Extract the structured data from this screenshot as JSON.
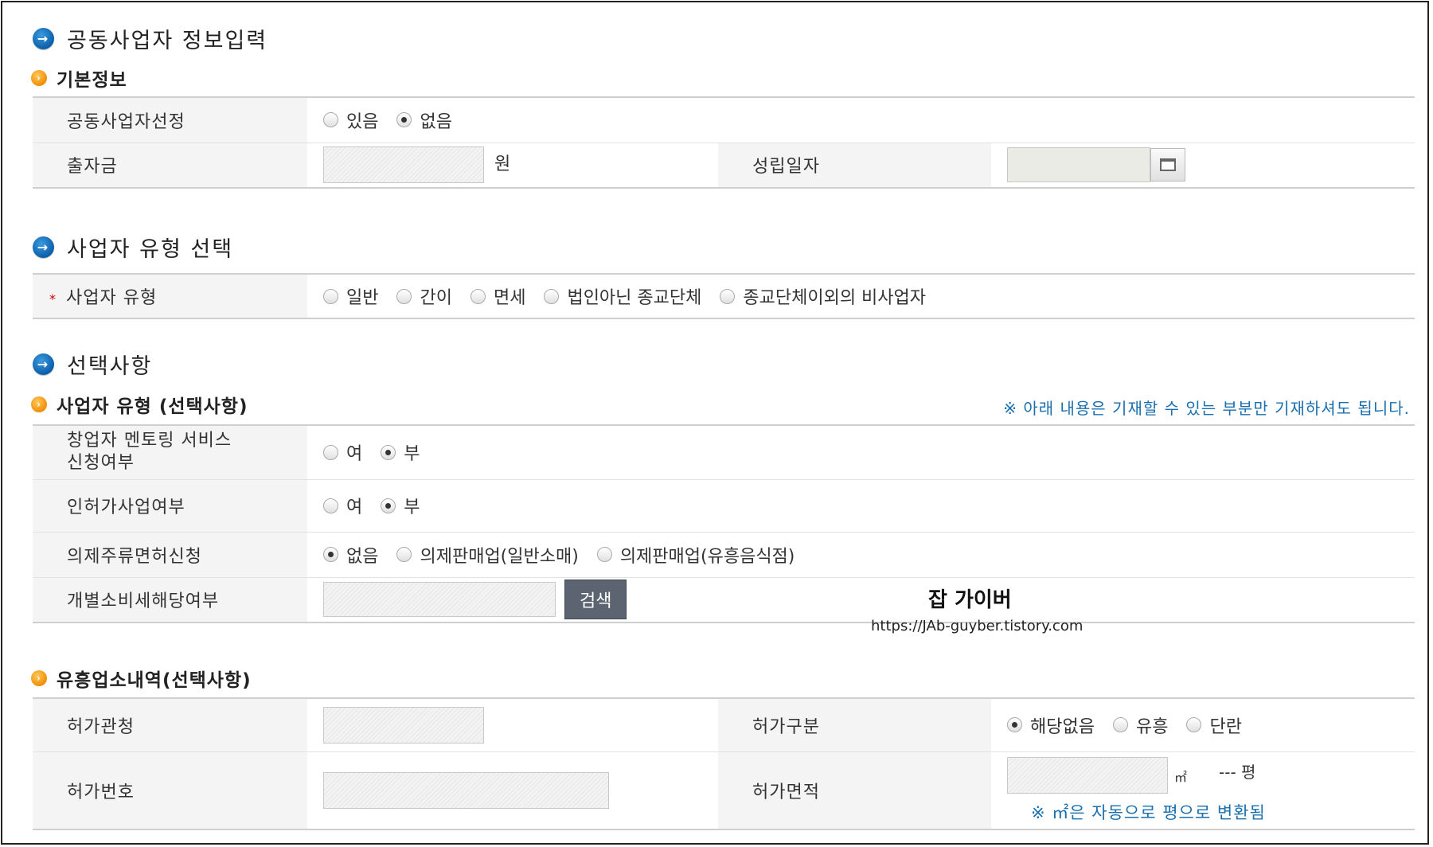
{
  "section1": {
    "title": "공동사업자 정보입력",
    "sub": "기본정보",
    "row1": {
      "label": "공동사업자선정",
      "options": [
        "있음",
        "없음"
      ]
    },
    "row2": {
      "label": "출자금",
      "unit": "원",
      "label2": "성립일자"
    }
  },
  "section2": {
    "title": "사업자 유형 선택",
    "row": {
      "required_mark": "*",
      "label": "사업자 유형",
      "options": [
        "일반",
        "간이",
        "면세",
        "법인아닌 종교단체",
        "종교단체이외의 비사업자"
      ]
    }
  },
  "section3": {
    "title": "선택사항",
    "sub": "사업자 유형 (선택사항)",
    "note": "※ 아래 내용은 기재할 수 있는 부분만 기재하셔도 됩니다.",
    "row1": {
      "label_line1": "창업자 멘토링 서비스",
      "label_line2": "신청여부",
      "options": [
        "여",
        "부"
      ]
    },
    "row2": {
      "label": "인허가사업여부",
      "options": [
        "여",
        "부"
      ]
    },
    "row3": {
      "label": "의제주류면허신청",
      "options": [
        "없음",
        "의제판매업(일반소매)",
        "의제판매업(유흥음식점)"
      ]
    },
    "row4": {
      "label": "개별소비세해당여부",
      "button": "검색"
    }
  },
  "watermark": {
    "title": "잡 가이버",
    "url": "https://JAb-guyber.tistory.com"
  },
  "section4": {
    "sub": "유흥업소내역(선택사항)",
    "row1": {
      "label": "허가관청",
      "label2": "허가구분",
      "options": [
        "해당없음",
        "유흥",
        "단란"
      ]
    },
    "row2": {
      "label": "허가번호",
      "label2": "허가면적",
      "unit": "㎡",
      "pyeong": "--- 평",
      "note": "※ ㎡은 자동으로 평으로 변환됨"
    }
  }
}
